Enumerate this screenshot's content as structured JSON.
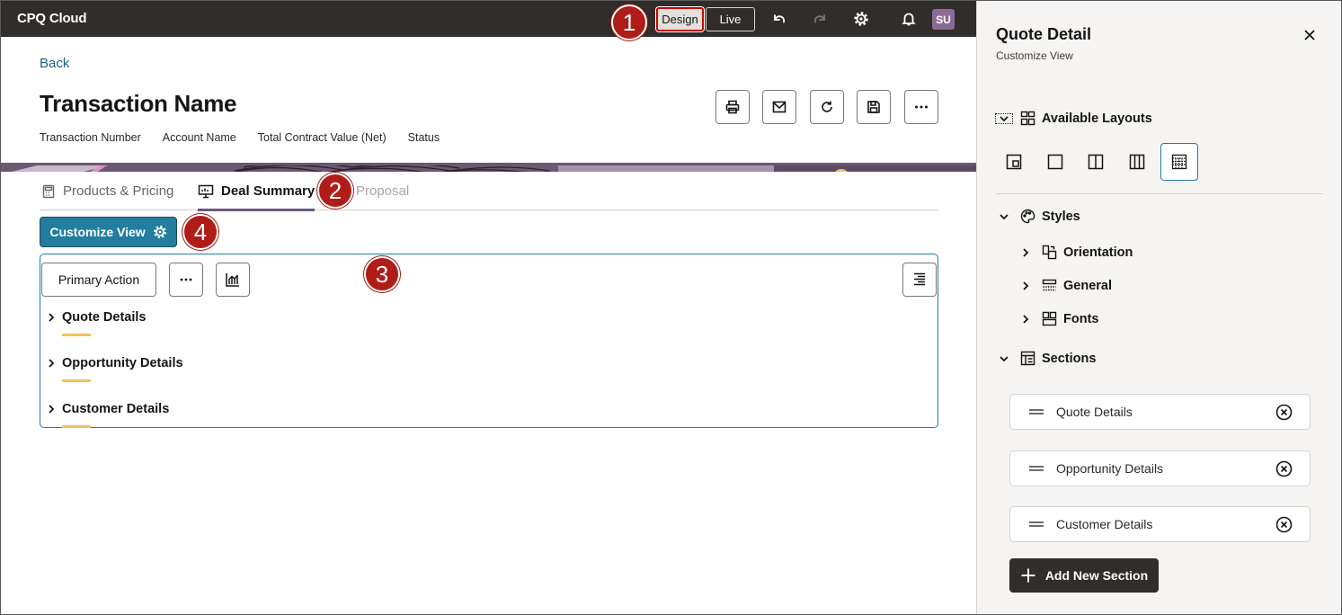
{
  "topbar": {
    "app_title": "CPQ Cloud",
    "design_label": "Design",
    "live_label": "Live",
    "avatar_initials": "SU",
    "icons": [
      "undo-icon",
      "redo-icon",
      "settings-icon",
      "notifications-icon"
    ]
  },
  "header": {
    "back_label": "Back",
    "title": "Transaction Name",
    "meta": [
      "Transaction Number",
      "Account Name",
      "Total Contract Value (Net)",
      "Status"
    ],
    "actions": [
      "print-icon",
      "email-icon",
      "refresh-icon",
      "save-icon",
      "more-icon"
    ]
  },
  "tabs": [
    {
      "label": "Products & Pricing",
      "state": "normal"
    },
    {
      "label": "Deal Summary",
      "state": "active"
    },
    {
      "label": "Proposal",
      "state": "disabled"
    }
  ],
  "callouts": [
    "1",
    "2",
    "3",
    "4"
  ],
  "customize_button": {
    "label": "Customize View"
  },
  "panel": {
    "primary_action_label": "Primary Action",
    "sections": [
      "Quote Details",
      "Opportunity Details",
      "Customer Details"
    ]
  },
  "drawer": {
    "title": "Quote Detail",
    "subtitle": "Customize View",
    "available_layouts_label": "Available Layouts",
    "styles_label": "Styles",
    "style_items": [
      "Orientation",
      "General",
      "Fonts"
    ],
    "sections_label": "Sections",
    "section_cards": [
      "Quote Details",
      "Opportunity Details",
      "Customer Details"
    ],
    "add_section_label": "Add New Section"
  },
  "colors": {
    "topbar": "#312d2a",
    "accent": "#227e9e",
    "callout": "#b01c17",
    "tab_indicator": "#6c5a7d",
    "section_underline": "#f1c35d"
  }
}
